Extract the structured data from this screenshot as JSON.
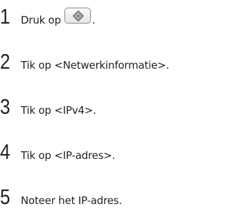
{
  "steps": [
    {
      "number": "1",
      "text_before": "Druk op",
      "text_after": "."
    },
    {
      "number": "2",
      "text": "Tik op <Netwerkinformatie>."
    },
    {
      "number": "3",
      "text": "Tik op <IPv4>."
    },
    {
      "number": "4",
      "text": "Tik op <IP-adres>."
    },
    {
      "number": "5",
      "text": "Noteer het IP-adres."
    }
  ],
  "icons": {
    "menu_button": "menu-home-icon"
  }
}
